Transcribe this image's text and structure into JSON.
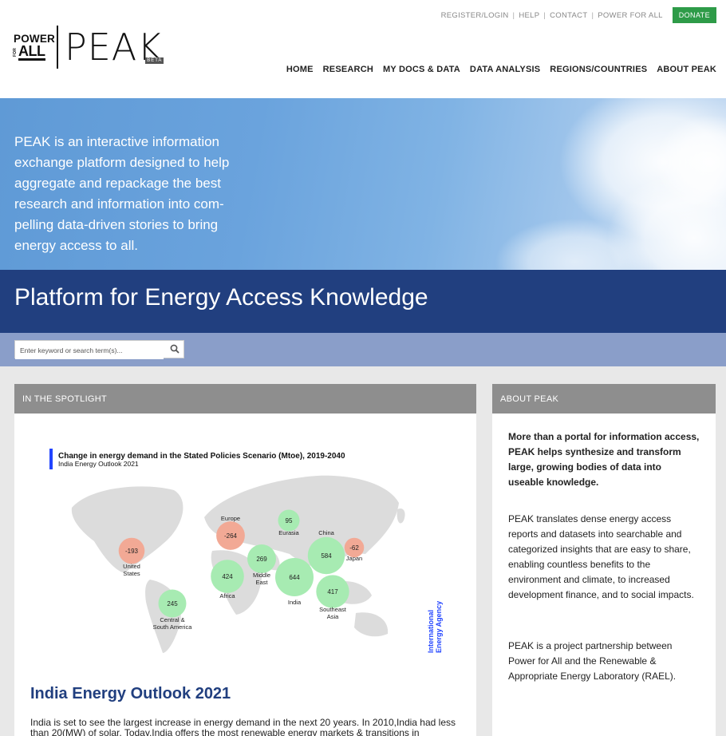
{
  "top_links": [
    "REGISTER/LOGIN",
    "HELP",
    "CONTACT",
    "POWER FOR ALL"
  ],
  "donate_label": "DONATE",
  "logo": {
    "line1": "POWER",
    "line2_small": "FOR",
    "line2": "ALL",
    "peak": "PEAK",
    "beta": "BETA"
  },
  "nav": [
    "HOME",
    "RESEARCH",
    "MY DOCS & DATA",
    "DATA ANALYSIS",
    "REGIONS/COUNTRIES",
    "ABOUT PEAK"
  ],
  "hero_text": "PEAK is an interactive information exchange platform designed to help aggregate and repackage the best research and information into com-pelling data-driven stories to bring energy access to all.",
  "band_title": "Platform for Energy Access Knowledge",
  "search": {
    "placeholder": "Enter keyword or search term(s)..."
  },
  "spotlight": {
    "heading": "IN THE SPOTLIGHT",
    "chart_title": "Change in energy demand in the Stated Policies Scenario (Mtoe), 2019-2040",
    "chart_subtitle": "India Energy Outlook 2021",
    "chart_source": [
      "International",
      "Energy Agency"
    ],
    "article_title": "India Energy Outlook 2021",
    "article_text": "India is set to see the largest increase in energy demand in the next 20 years. In 2010,India had less than 20(MW) of solar. Today,India offers the most renewable energy markets & transitions in"
  },
  "chart_data": {
    "type": "bubble-map",
    "title": "Change in energy demand in the Stated Policies Scenario (Mtoe), 2019-2040",
    "subtitle": "India Energy Outlook 2021",
    "colors": {
      "increase": "#a7ebb2",
      "decrease": "#f2a995"
    },
    "regions": [
      {
        "name": "United States",
        "label_lines": [
          "United",
          "States"
        ],
        "value": -193
      },
      {
        "name": "Europe",
        "label_lines": [
          "Europe"
        ],
        "value": -264
      },
      {
        "name": "Eurasia",
        "label_lines": [
          "Eurasia"
        ],
        "value": 95
      },
      {
        "name": "China",
        "label_lines": [
          "China"
        ],
        "value": 584
      },
      {
        "name": "Japan",
        "label_lines": [
          "Japan"
        ],
        "value": -62
      },
      {
        "name": "Middle East",
        "label_lines": [
          "Middle",
          "East"
        ],
        "value": 269
      },
      {
        "name": "Africa",
        "label_lines": [
          "Africa"
        ],
        "value": 424
      },
      {
        "name": "India",
        "label_lines": [
          "India"
        ],
        "value": 644
      },
      {
        "name": "Southeast Asia",
        "label_lines": [
          "Southeast",
          "Asia"
        ],
        "value": 417
      },
      {
        "name": "Central & South America",
        "label_lines": [
          "Central &",
          "South America"
        ],
        "value": 245
      }
    ]
  },
  "about": {
    "heading": "ABOUT PEAK",
    "p1": "More than a portal for information access, PEAK helps synthesize and transform large, growing bodies of data into useable knowledge.",
    "p2": "PEAK translates dense energy access reports and datasets into searchable and categorized insights that are easy to share, enabling countless benefits to the environment and climate, to increased development finance, and to social impacts.",
    "p3": "PEAK is a project partnership between Power for All and the Renewable & Appropriate Energy Laboratory (RAEL)."
  }
}
